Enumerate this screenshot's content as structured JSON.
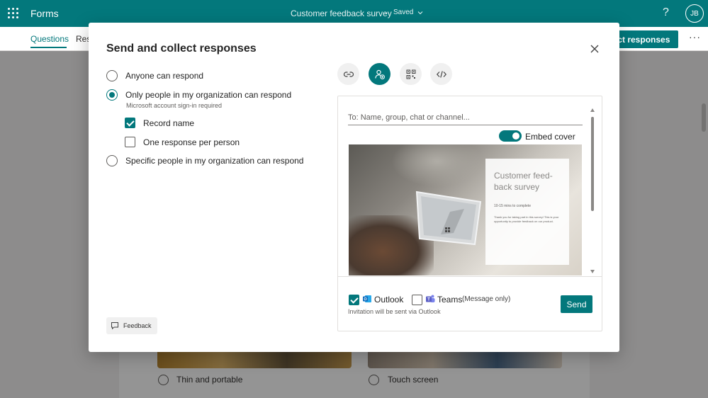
{
  "app": {
    "name": "Forms",
    "doc_title": "Customer feedback survey",
    "doc_separator": "-",
    "doc_status": "Saved",
    "help": "?",
    "avatar_initials": "JB"
  },
  "tabs": {
    "questions": "Questions",
    "responses": "Res"
  },
  "toolbar": {
    "collect_label": "Collect responses",
    "more": "···"
  },
  "background_form": {
    "option_1": "Thin and portable",
    "option_2": "Touch screen"
  },
  "modal": {
    "title": "Send and collect responses",
    "options": [
      {
        "label": "Anyone can respond",
        "selected": false
      },
      {
        "label": "Only people in my organization can respond",
        "selected": true,
        "note": "Microsoft account sign-in required"
      },
      {
        "label": "Specific people in my organization can respond",
        "selected": false
      }
    ],
    "settings": [
      {
        "label": "Record name",
        "checked": true
      },
      {
        "label": "One response per person",
        "checked": false
      }
    ],
    "feedback_label": "Feedback",
    "share_methods": [
      {
        "icon": "link-icon",
        "active": false
      },
      {
        "icon": "invite-person-icon",
        "active": true
      },
      {
        "icon": "qr-code-icon",
        "active": false
      },
      {
        "icon": "embed-code-icon",
        "active": false
      }
    ],
    "invite": {
      "to_placeholder": "To: Name, group, chat or channel...",
      "embed_cover_label": "Embed cover",
      "embed_cover_on": true,
      "cover": {
        "title": "Customer feed-back survey",
        "time": "10-15 mins to complete",
        "description": "Thank you for taking part in this survey! This is your opportunity to provide feedback on our product."
      },
      "outlook_label": "Outlook",
      "outlook_checked": true,
      "teams_label": "Teams",
      "teams_checked": false,
      "teams_note": "(Message only)",
      "invitation_note": "Invitation will be sent via Outlook",
      "send_label": "Send"
    }
  },
  "colors": {
    "brand": "#03787c",
    "outlook": "#0f6cbd",
    "teams": "#5b5fc7"
  }
}
